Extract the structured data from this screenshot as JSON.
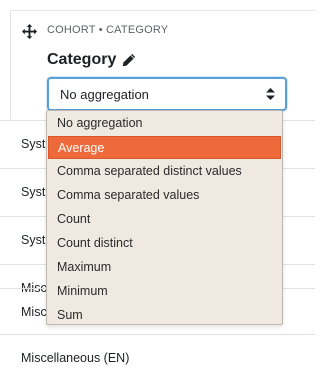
{
  "panel": {
    "breadcrumb": "COHORT • CATEGORY",
    "title": "Category",
    "aggregation_select": {
      "value": "No aggregation"
    }
  },
  "rows": [
    {
      "label": "Syst"
    },
    {
      "label": "Syst"
    },
    {
      "label": "Syst"
    },
    {
      "label": "Misc"
    },
    {
      "label": "Misc"
    },
    {
      "label": "Miscellaneous (EN)"
    }
  ],
  "dropdown": {
    "selected_index": 1,
    "options": [
      "No aggregation",
      "Average",
      "Comma separated distinct values",
      "Comma separated values",
      "Count",
      "Count distinct",
      "Maximum",
      "Minimum",
      "Sum"
    ]
  },
  "colors": {
    "selected_option_bg": "#ee6a3b",
    "dropdown_bg": "#efe9e2",
    "focus_border": "#5aa0d8"
  },
  "icons": [
    "move-icon",
    "pencil-icon",
    "sort-caret-icon"
  ]
}
